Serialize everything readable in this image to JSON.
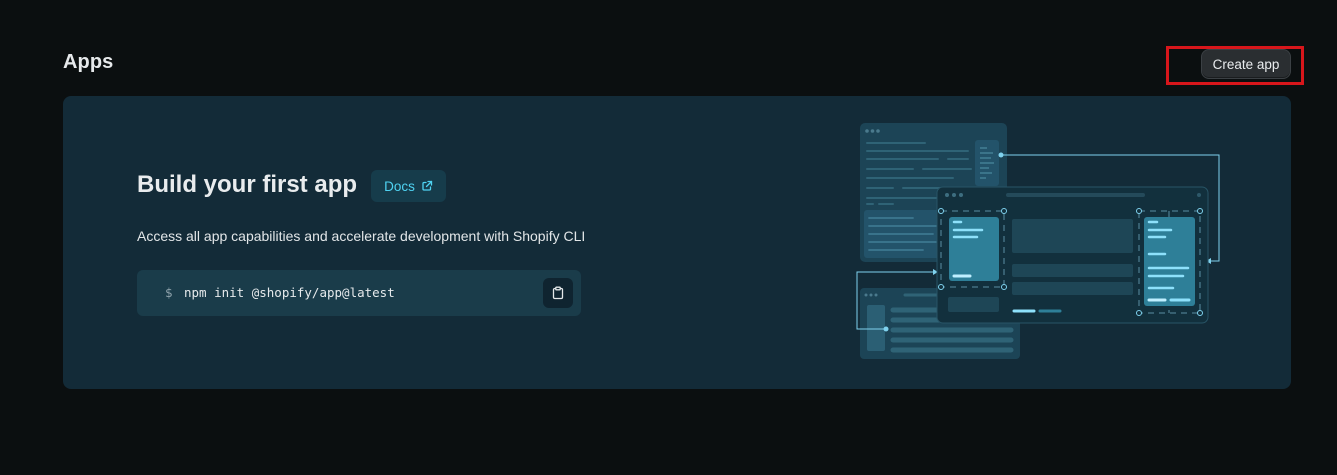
{
  "header": {
    "title": "Apps",
    "create_button_label": "Create app"
  },
  "empty_state": {
    "heading": "Build your first app",
    "docs_label": "Docs",
    "description": "Access all app capabilities and accelerate development with Shopify CLI",
    "command_prompt": "$",
    "command": "npm init @shopify/app@latest"
  },
  "icons": {
    "docs": "external-link-icon",
    "copy": "clipboard-icon"
  },
  "colors": {
    "background": "#0b0f10",
    "card": "#132b38",
    "accent": "#4fd3f2",
    "highlight": "#d8161b"
  }
}
